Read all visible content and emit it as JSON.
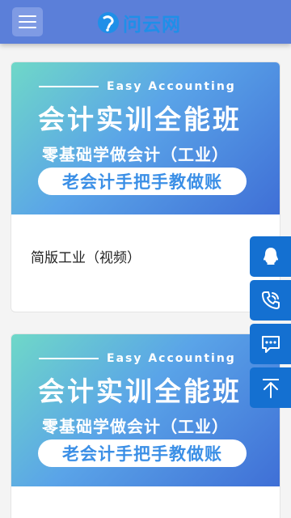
{
  "header": {
    "logo_text": "问云网"
  },
  "cards": [
    {
      "banner": {
        "tagline": "Easy Accounting",
        "title": "会计实训全能班",
        "subtitle": "零基础学做会计（工业）",
        "pill": "老会计手把手教做账"
      },
      "title": "简版工业（视频）"
    },
    {
      "banner": {
        "tagline": "Easy Accounting",
        "title": "会计实训全能班",
        "subtitle": "零基础学做会计（工业）",
        "pill": "老会计手把手教做账"
      }
    }
  ],
  "side_buttons": [
    {
      "icon": "qq-icon"
    },
    {
      "icon": "phone-icon"
    },
    {
      "icon": "chat-icon"
    },
    {
      "icon": "back-to-top-icon"
    }
  ],
  "colors": {
    "header": "#5b7fd9",
    "logo": "#1f8fe8",
    "side_button": "#1470d1"
  }
}
